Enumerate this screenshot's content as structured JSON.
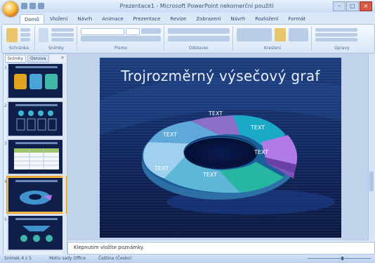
{
  "window": {
    "title": "Prezentace1 - Microsoft PowerPoint nekomerční použití",
    "controls": {
      "minimize": "–",
      "maximize": "□",
      "close": "×"
    }
  },
  "ribbon": {
    "tabs": [
      {
        "label": "Domů",
        "active": true
      },
      {
        "label": "Vložení",
        "active": false
      },
      {
        "label": "Návrh",
        "active": false
      },
      {
        "label": "Animace",
        "active": false
      },
      {
        "label": "Prezentace",
        "active": false
      },
      {
        "label": "Revize",
        "active": false
      },
      {
        "label": "Zobrazení",
        "active": false
      },
      {
        "label": "Návrh",
        "active": false
      },
      {
        "label": "Rozložení",
        "active": false
      },
      {
        "label": "Formát",
        "active": false
      }
    ],
    "groups": [
      "Schránka",
      "Snímky",
      "Písmo",
      "Odstavec",
      "Kreslení",
      "Úpravy"
    ]
  },
  "left_pane": {
    "tabs": [
      "Snímky",
      "Osnova"
    ],
    "close": "×",
    "slide_numbers": [
      "1",
      "2",
      "3",
      "4",
      "5"
    ]
  },
  "slide": {
    "title": "Trojrozměrný výsečový graf",
    "segment_labels": [
      "TEXT",
      "TEXT",
      "TEXT",
      "TEXT",
      "TEXT",
      "TEXT"
    ],
    "colors": {
      "background": "#0c1a44",
      "segment_purple": "#8c6fc9",
      "segment_teal": "#1ba9c8",
      "segment_violet": "#b07be6",
      "segment_green": "#27b6a2",
      "segment_light_blue": "#5fa8da",
      "segment_blue": "#3f92cc"
    }
  },
  "notes": {
    "placeholder": "Klepnutím vložíte poznámky."
  },
  "status_bar": {
    "slide": "Snímek 4 z 5",
    "theme": "Motiv sady Office",
    "language": "Čeština (Česko)"
  }
}
